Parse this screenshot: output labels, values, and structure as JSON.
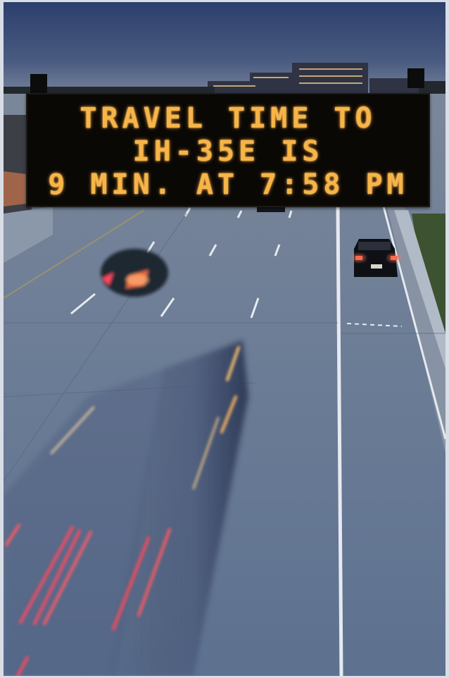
{
  "sign": {
    "line1": "TRAVEL TIME TO",
    "line2": "IH-35E IS",
    "line3": "9 MIN. AT 7:58 PM"
  },
  "colors": {
    "sky_top": "#2f4270",
    "sky_horizon": "#7f8da3",
    "road": "#66788f",
    "sign_text": "#f7b548",
    "tail_light": "#ff4a52",
    "head_light": "#ffc66b"
  }
}
